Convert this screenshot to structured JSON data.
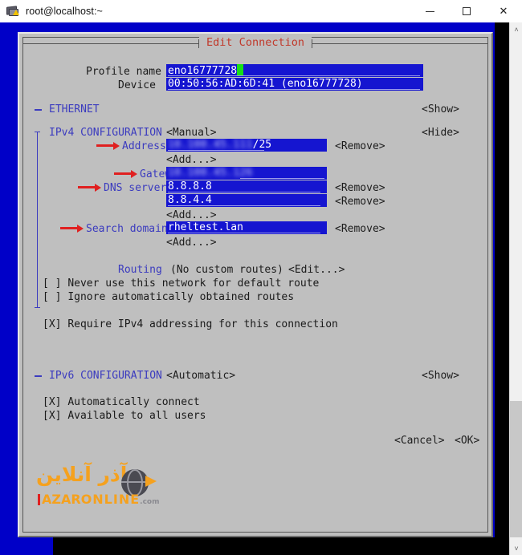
{
  "window": {
    "title": "root@localhost:~",
    "icon": "putty-terminal-icon",
    "controls": {
      "minimize": "minimize-button",
      "maximize": "maximize-button",
      "close_label": "✕"
    }
  },
  "dialog": {
    "title": "Edit Connection",
    "title_color": "#c0392b",
    "background": "#bfbfbf",
    "terminal_background": "#0000c8"
  },
  "form": {
    "profile_name_label": "Profile name",
    "profile_name_value": "eno16777728",
    "device_label": "Device",
    "device_value": "00:50:56:AD:6D:41 (eno16777728)",
    "ethernet_section": "ETHERNET",
    "ethernet_show": "<Show>",
    "ipv4_section": "IPv4 CONFIGURATION",
    "ipv4_mode": "<Manual>",
    "ipv4_hide": "<Hide>",
    "addresses_label": "Addresses",
    "addresses_value_redacted": "10.100.45.111",
    "addresses_prefix": "/25",
    "addresses_remove": "<Remove>",
    "addresses_add": "<Add...>",
    "gateway_label": "Gateway",
    "gateway_value_redacted": "10.100.45.126",
    "dns_label": "DNS servers",
    "dns_value_1": "8.8.8.8",
    "dns_remove_1": "<Remove>",
    "dns_value_2": "8.8.4.4",
    "dns_remove_2": "<Remove>",
    "dns_add": "<Add...>",
    "search_label": "Search domains",
    "search_value": "rheltest.lan",
    "search_remove": "<Remove>",
    "search_add": "<Add...>",
    "routing_label": "Routing",
    "routing_value": "(No custom routes)",
    "routing_edit": "<Edit...>",
    "check_never_default": "Never use this network for default route",
    "check_never_default_state": "[ ]",
    "check_ignore_routes": "Ignore automatically obtained routes",
    "check_ignore_routes_state": "[ ]",
    "check_require_ipv4": "Require IPv4 addressing for this connection",
    "check_require_ipv4_state": "[X]",
    "ipv6_section": "IPv6 CONFIGURATION",
    "ipv6_mode": "<Automatic>",
    "ipv6_show": "<Show>",
    "check_auto_connect": "Automatically connect",
    "check_auto_connect_state": "[X]",
    "check_all_users": "Available to all users",
    "check_all_users_state": "[X]",
    "cancel_button": "<Cancel>",
    "ok_button": "<OK>"
  },
  "watermark": {
    "persian": "آذر آنلاین",
    "azar": "AZAR",
    "online": "ONLINE",
    "com": ".com",
    "accent": "#f5a11e"
  },
  "scrollbar": {
    "up_arrow": "˄",
    "down_arrow": "˅"
  }
}
